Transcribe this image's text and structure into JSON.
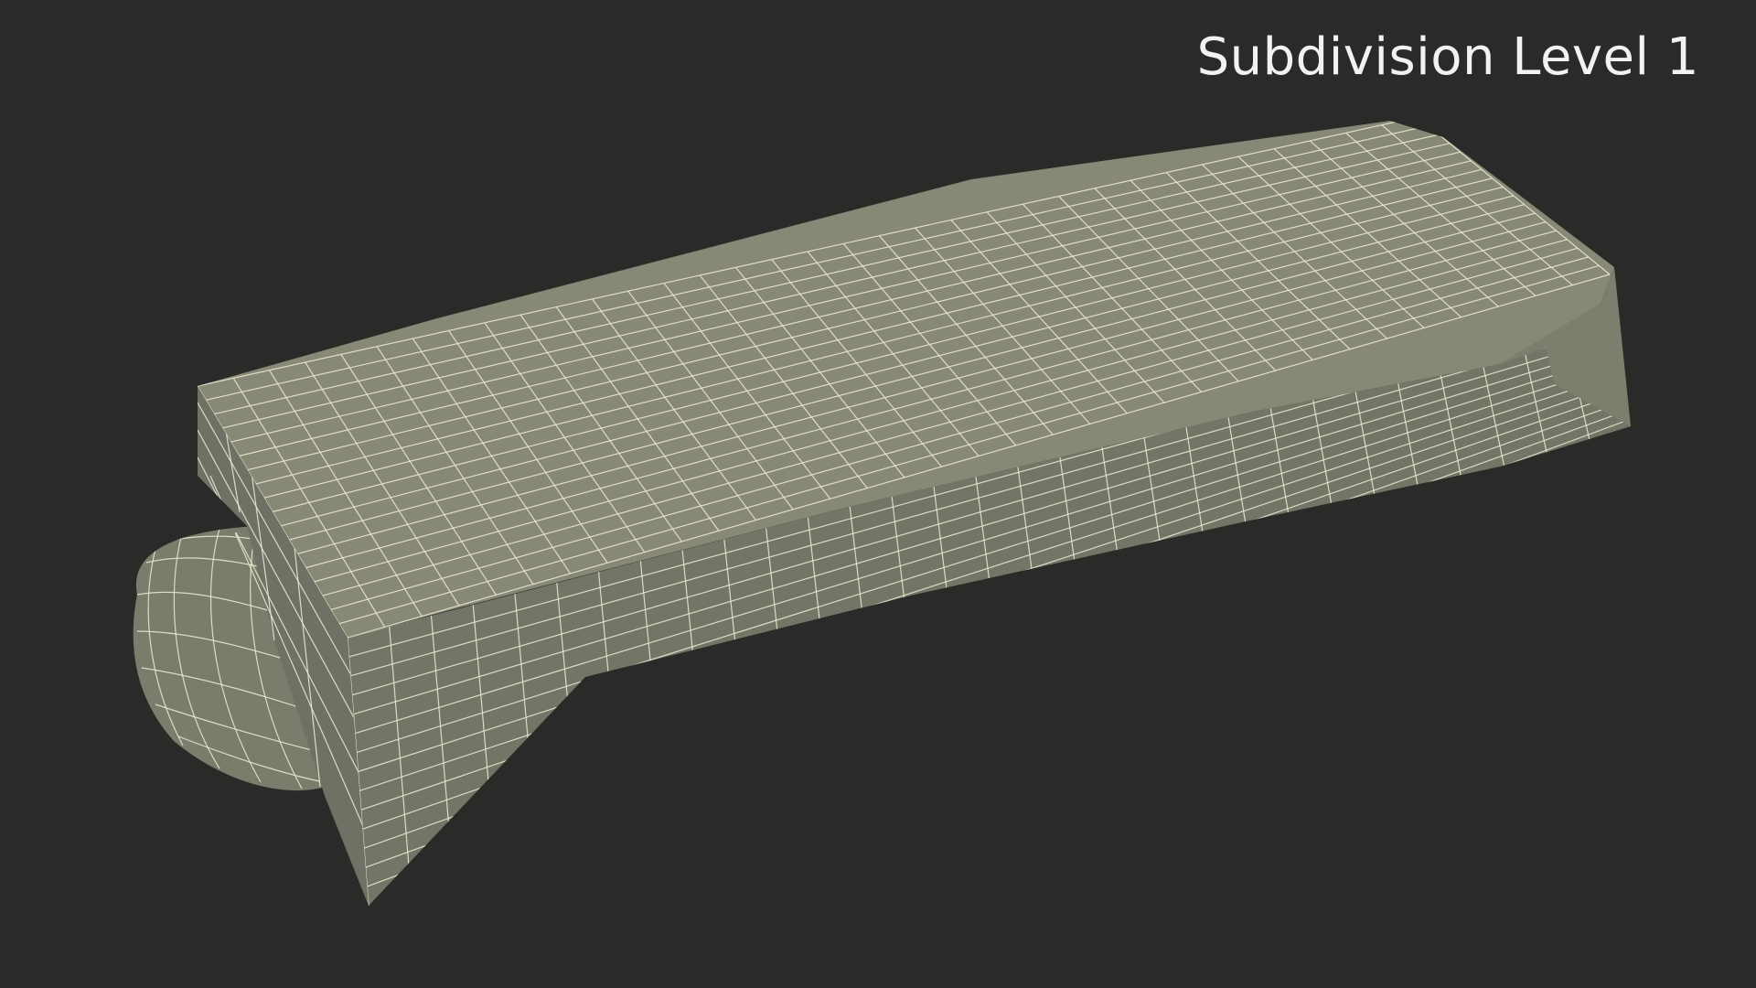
{
  "viewport": {
    "label": "Subdivision Level 1"
  },
  "colors": {
    "background": "#2a2a28",
    "mesh_fill_top": "#8a8b76",
    "mesh_fill_side": "#74766a",
    "wireframe": "#e8e7cf",
    "label_text": "#f2f2f2"
  }
}
